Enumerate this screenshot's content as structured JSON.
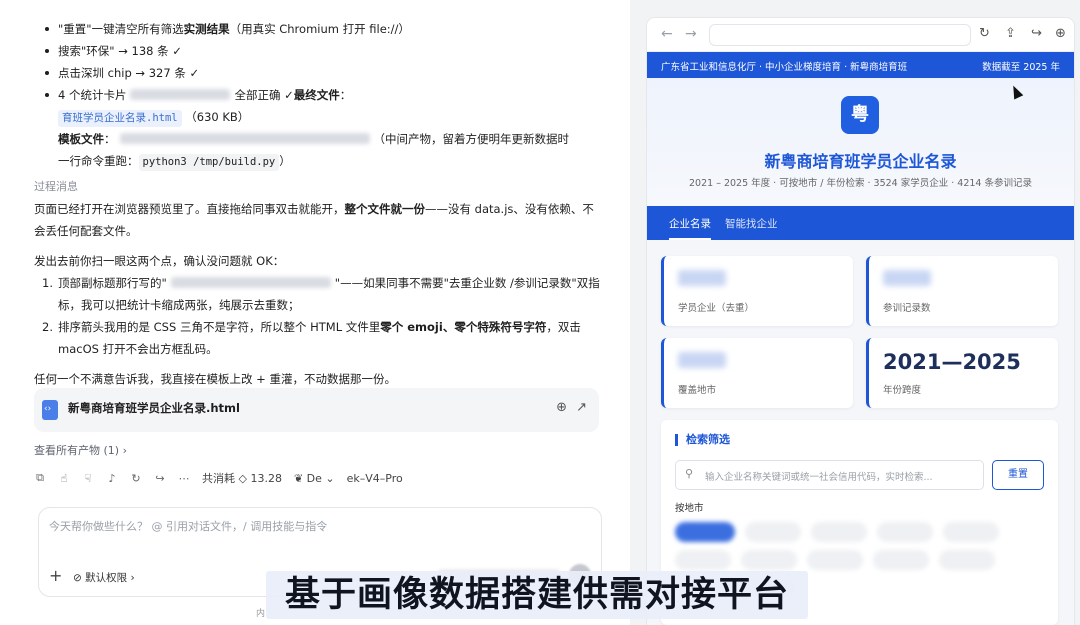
{
  "chat": {
    "bullets": [
      {
        "pre": "\"重置\"一键清空所有筛选",
        "bold": "实测结果",
        "post": "（用真实 Chromium 打开 file://）"
      },
      {
        "text": "搜索\"环保\" → 138 条 ✓"
      },
      {
        "text": "点击深圳 chip → 327 条 ✓"
      },
      {
        "pre": "4 个统计卡片",
        "post": "全部正确 ✓",
        "bold": "最终文件",
        "tail": "："
      }
    ],
    "file_link": "育班学员企业名录.html",
    "file_size": "（630 KB）",
    "template_label": "模板文件",
    "template_note": "（中间产物，留着方便明年更新数据时",
    "rerun_label": "一行命令重跑：",
    "rerun_cmd": "python3 /tmp/build.py",
    "rerun_tail": "）",
    "process_title": "过程消息",
    "para1_a": "页面已经打开在浏览器预览里了。直接拖给同事双击就能开，",
    "para1_b": "整个文件就一份",
    "para1_c": "——没有 data.js、没有依赖、不会丢任何配套文件。",
    "para2": "发出去前你扫一眼这两个点，确认没问题就 OK：",
    "list": [
      {
        "num": "1.",
        "a": "顶部副标题那行写的\"",
        "b": "\"——如果同事不需要\"去重企业数 /参训记录数\"双指标，我可以把统计卡缩成两张，纯展示去重数；"
      },
      {
        "num": "2.",
        "a": "排序箭头我用的是 CSS 三角不是字符，所以整个 HTML 文件里",
        "b": "零个 emoji、零个特殊符号字符",
        "c": "，双击 macOS 打开不会出方框乱码。"
      }
    ],
    "para3": "任何一个不满意告诉我，我直接在模板上改 + 重灌，不动数据那一份。",
    "file_card_name": "新粤商培育班学员企业名录.html",
    "view_all": "查看所有产物 (1) ›",
    "usage": "共消耗 ◇ 13.28",
    "model_a": "De",
    "model_b": "ek–V4–Pro",
    "composer_placeholder": "今天帮你做些什么？ @ 引用对话文件，/ 调用技能与指令",
    "permission": "默认权限 ›",
    "footer_hint": "内"
  },
  "browser": {
    "strip_left": "广东省工业和信息化厅 · 中小企业梯度培育 · 新粤商培育班",
    "strip_right": "数据截至 2025 年",
    "logo_char": "粤",
    "title": "新粤商培育班学员企业名录",
    "subtitle": "2021 – 2025 年度 · 可按地市 / 年份检索 · 3524 家学员企业 · 4214 条参训记录",
    "tabs": [
      "企业名录",
      "智能找企业"
    ],
    "stats": [
      {
        "label": "学员企业（去重）"
      },
      {
        "label": "参训记录数"
      },
      {
        "label": "覆盖地市"
      },
      {
        "value": "2021—2025",
        "label": "年份跨度"
      }
    ],
    "filter_title": "检索筛选",
    "search_placeholder": "输入企业名称关键词或统一社会信用代码，实时检索...",
    "reset_label": "重置",
    "by_city": "按地市"
  },
  "caption": "基于画像数据搭建供需对接平台",
  "colors": {
    "brand": "#1d56d6",
    "accent": "#1f5fe0"
  }
}
